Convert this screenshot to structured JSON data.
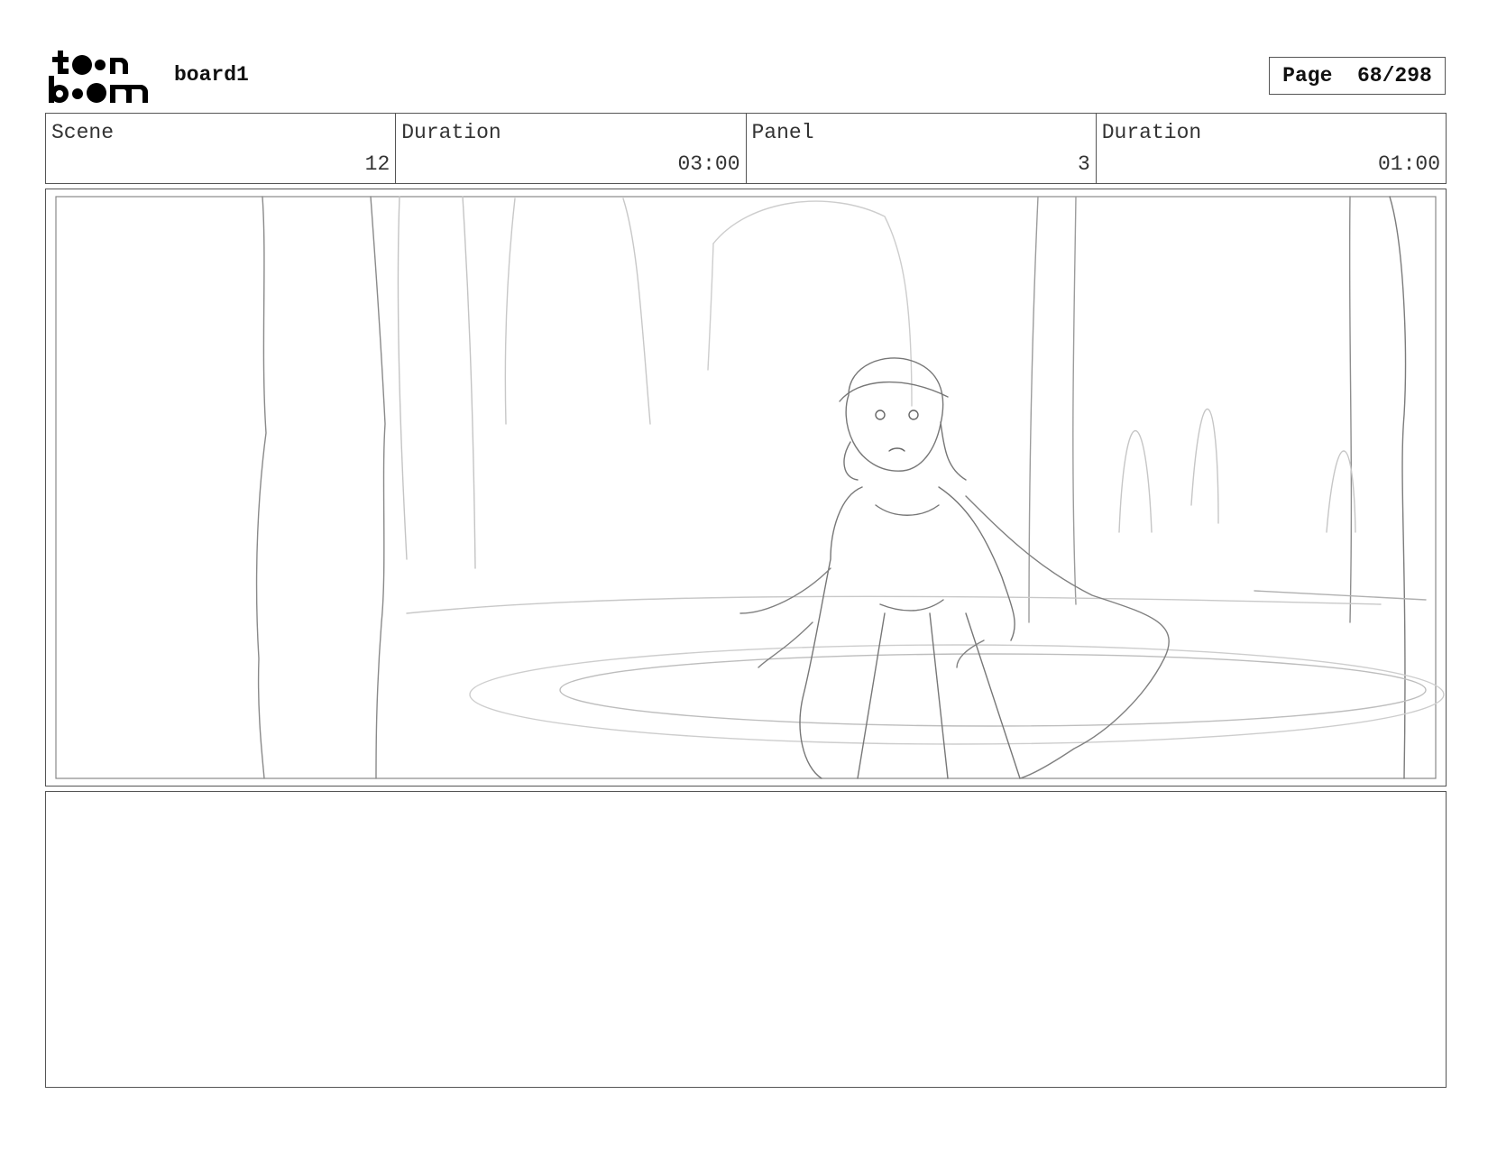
{
  "header": {
    "logo_text": "toon boom",
    "board_name": "board1",
    "page_label": "Page",
    "page_number": "68/298"
  },
  "info": {
    "scene_label": "Scene",
    "scene_value": "12",
    "scene_duration_label": "Duration",
    "scene_duration_value": "03:00",
    "panel_label": "Panel",
    "panel_value": "3",
    "panel_duration_label": "Duration",
    "panel_duration_value": "01:00"
  },
  "panel": {
    "sketch_icon": "storyboard-sketch",
    "sketch_stroke_color": "#9a9a9a"
  },
  "notes": {
    "text": ""
  }
}
